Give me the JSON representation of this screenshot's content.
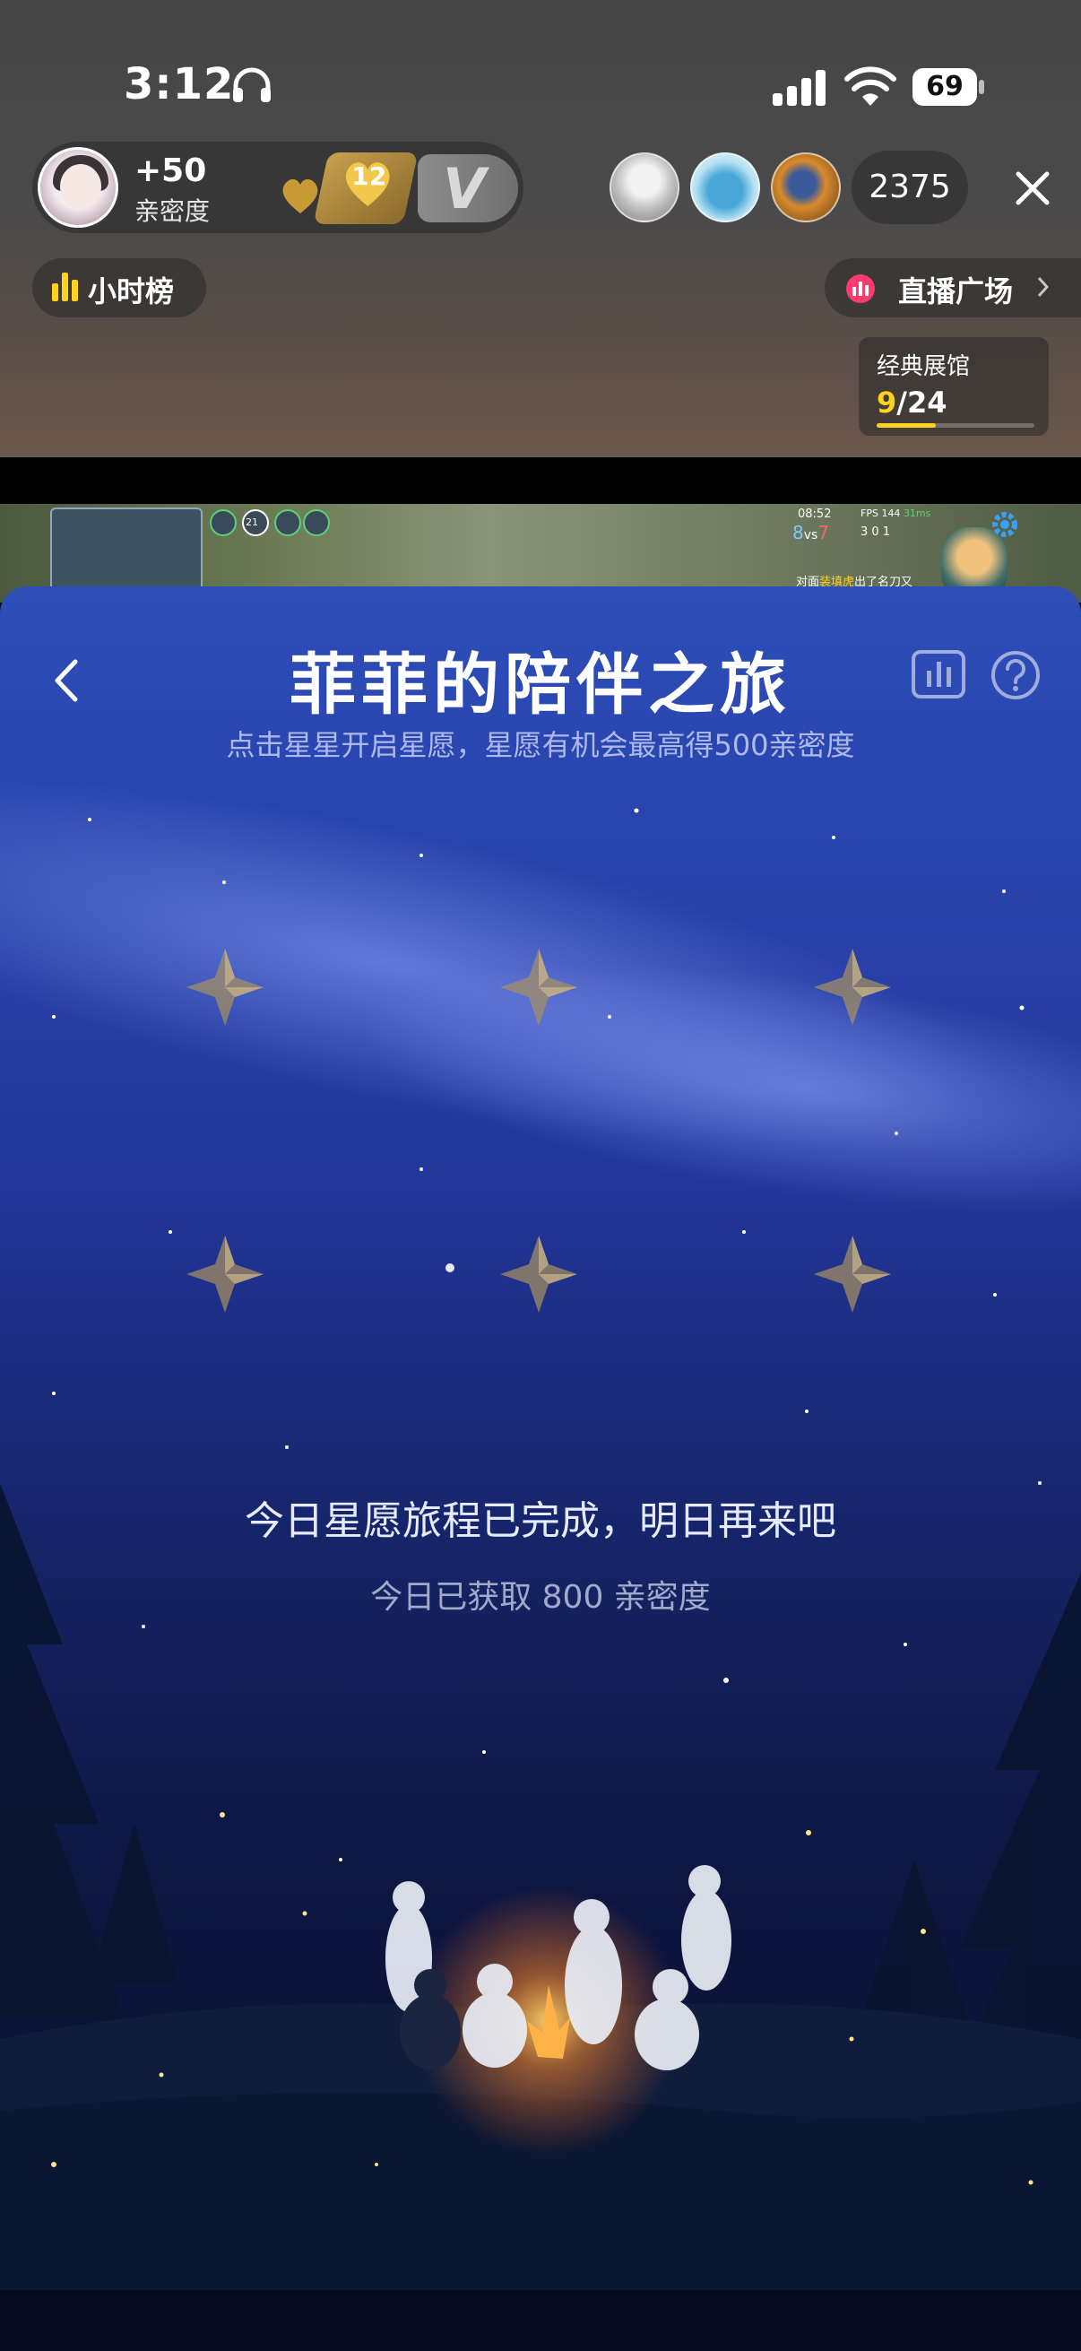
{
  "status_bar": {
    "time": "3:12",
    "battery": "69"
  },
  "anchor": {
    "intimacy_delta": "+50",
    "intimacy_label": "亲密度",
    "heart_level": "12",
    "v_badge": "V"
  },
  "viewers": {
    "count": "2375"
  },
  "hour_rank": {
    "label": "小时榜"
  },
  "live_plaza": {
    "label": "直播广场"
  },
  "gallery": {
    "title": "经典展馆",
    "current": "9",
    "total": "/24",
    "progress": 0.375
  },
  "game": {
    "clock": "08:52",
    "fps": "FPS 144",
    "ping": "31ms",
    "score_blue": "8",
    "score_vs": "vs",
    "score_red": "7",
    "kda": "3  0  1",
    "hero_level": "21",
    "message_prefix": "对面",
    "message_highlight": "装填虎",
    "message_suffix": "出了名刀又"
  },
  "panel": {
    "title": "菲菲的陪伴之旅",
    "subtitle": "点击星星开启星愿，星愿有机会最高得500亲密度",
    "completed_message": "今日星愿旅程已完成，明日再来吧",
    "earned_message": "今日已获取 800 亲密度"
  },
  "colors": {
    "accent_yellow": "#ffd21e",
    "plaza_pink": "#ff3a6e",
    "panel_blue": "#2e4fb8"
  },
  "icons": [
    "headphones-icon",
    "signal-icon",
    "wifi-icon",
    "battery-icon",
    "close-icon",
    "bar-chart-icon",
    "live-plaza-icon",
    "chevron-right-icon",
    "back-icon",
    "leaderboard-icon",
    "help-icon",
    "star-icon",
    "gear-icon"
  ]
}
